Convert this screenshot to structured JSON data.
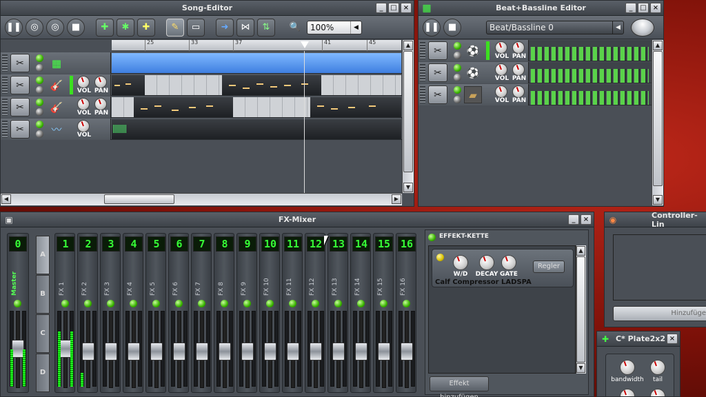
{
  "song_editor": {
    "title": "Song-Editor",
    "zoom": "100%",
    "ruler_ticks": [
      "25",
      "33",
      "37",
      "41",
      "45"
    ],
    "track_labels": {
      "vol": "VOL",
      "pan": "PAN"
    }
  },
  "bb_editor": {
    "title": "Beat+Bassline Editor",
    "selector": "Beat/Bassline 0",
    "labels": {
      "vol": "VOL",
      "pan": "PAN"
    }
  },
  "fx_mixer": {
    "title": "FX-Mixer",
    "channels": [
      {
        "num": "0",
        "name": "Master"
      },
      {
        "num": "1",
        "name": "FX 1"
      },
      {
        "num": "2",
        "name": "FX 2"
      },
      {
        "num": "3",
        "name": "FX 3"
      },
      {
        "num": "4",
        "name": "FX 4"
      },
      {
        "num": "5",
        "name": "FX 5"
      },
      {
        "num": "6",
        "name": "FX 6"
      },
      {
        "num": "7",
        "name": "FX 7"
      },
      {
        "num": "8",
        "name": "FX 8"
      },
      {
        "num": "9",
        "name": "FX 9"
      },
      {
        "num": "10",
        "name": "FX 10"
      },
      {
        "num": "11",
        "name": "FX 11"
      },
      {
        "num": "12",
        "name": "FX 12"
      },
      {
        "num": "13",
        "name": "FX 13"
      },
      {
        "num": "14",
        "name": "FX 14"
      },
      {
        "num": "15",
        "name": "FX 15"
      },
      {
        "num": "16",
        "name": "FX 16"
      }
    ],
    "banks": [
      "A",
      "B",
      "C",
      "D"
    ],
    "effect_chain": {
      "title": "EFFEKT-KETTE",
      "plugin_name": "Calf Compressor LADSPA",
      "knobs": [
        "W/D",
        "DECAY",
        "GATE"
      ],
      "controls_button": "Regler",
      "add_button": "Effekt hinzufügen"
    }
  },
  "controller_links": {
    "title": "Controller-Lin",
    "add_button": "Hinzufüge"
  },
  "plate": {
    "title": "C* Plate2x2",
    "knobs": [
      "bandwidth",
      "tail"
    ]
  },
  "colors": {
    "window_bg": "#4a4f56",
    "led_green": "#39b200",
    "lcd_green": "#36ff36",
    "clip_blue": "#3f7fe0",
    "desktop_red": "#c0281a"
  }
}
